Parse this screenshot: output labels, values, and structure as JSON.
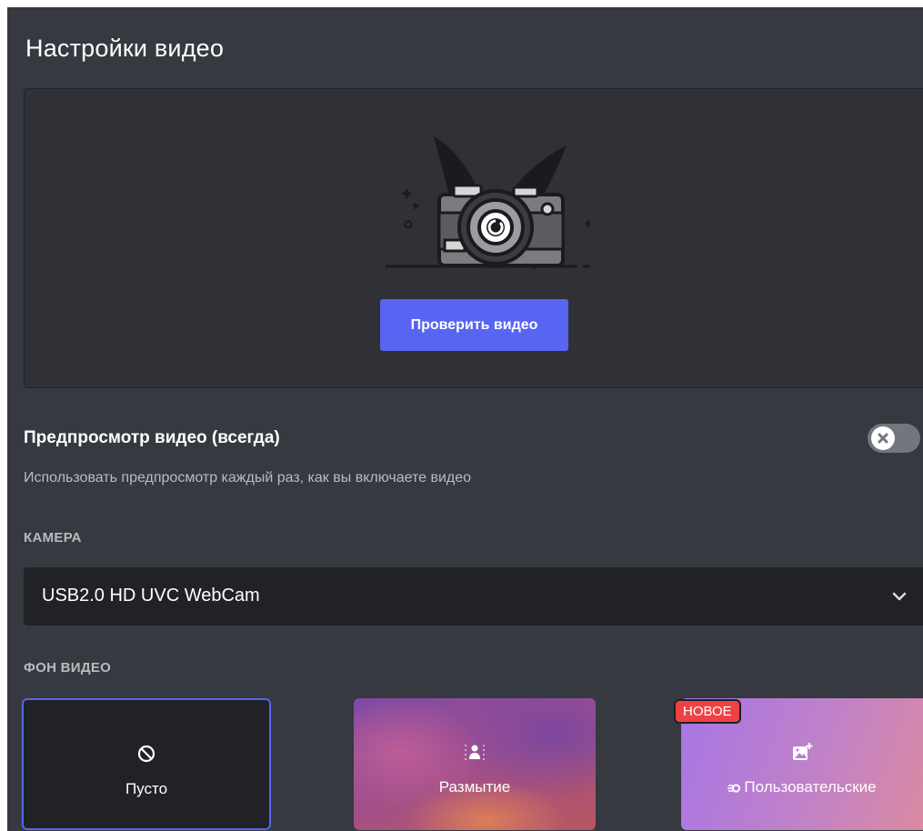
{
  "page": {
    "title": "Настройки видео"
  },
  "preview": {
    "test_button_label": "Проверить видео",
    "illustration": "camera-illustration"
  },
  "always_preview": {
    "title": "Предпросмотр видео (всегда)",
    "description": "Использовать предпросмотр каждый раз, как вы включаете видео",
    "enabled": false,
    "toggle_icon": "close-icon"
  },
  "camera": {
    "section_label": "КАМЕРА",
    "selected_value": "USB2.0 HD UVC WebCam",
    "dropdown_icon": "chevron-down-icon"
  },
  "background": {
    "section_label": "ФОН ВИДЕО",
    "options": [
      {
        "label": "Пусто",
        "icon": "no-entry-icon",
        "selected": true
      },
      {
        "label": "Размытие",
        "icon": "blur-person-icon",
        "selected": false
      },
      {
        "label": "Пользовательские",
        "icon": "add-image-icon",
        "label_icon": "nitro-icon",
        "badge": "НОВОЕ",
        "selected": false
      }
    ]
  },
  "colors": {
    "panel_bg": "#36393f",
    "preview_bg": "#2f3136",
    "input_bg": "#202225",
    "accent": "#5865f2",
    "badge_red": "#ed4245",
    "toggle_off": "#72767d"
  }
}
